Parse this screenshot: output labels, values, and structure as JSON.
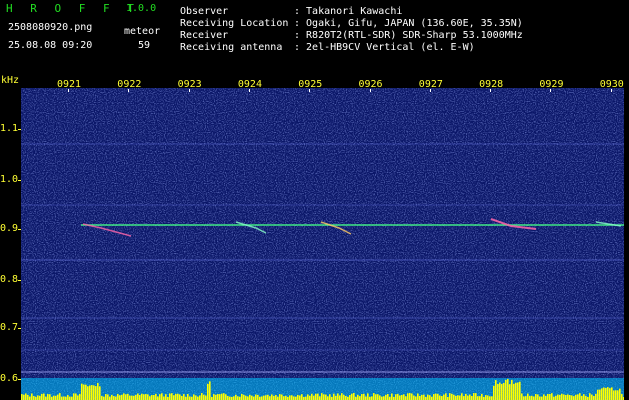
{
  "header": {
    "app_name": "H R O F F T",
    "app_version": "1.0.0",
    "filename": "2508080920.png",
    "datetime": "25.08.08 09:20",
    "meteor_label": "meteor",
    "meteor_count": "59"
  },
  "info": {
    "observer_label": "Observer",
    "observer_value": ": Takanori Kawachi",
    "location_label": "Receiving Location",
    "location_value": ": Ogaki, Gifu, JAPAN (136.60E, 35.35N)",
    "receiver_label": "Receiver",
    "receiver_value": ": R820T2(RTL-SDR) SDR-Sharp 53.1000MHz",
    "antenna_label": "Receiving antenna",
    "antenna_value": ": 2el-HB9CV Vertical (el. E-W)"
  },
  "chart_data": {
    "type": "heatmap",
    "ylabel": "kHz",
    "y_ticks": [
      "1.1",
      "1.0",
      "0.9",
      "0.8",
      "0.7",
      "0.6"
    ],
    "x_ticks": [
      "0921",
      "0922",
      "0923",
      "0924",
      "0925",
      "0926",
      "0927",
      "0928",
      "0929",
      "0930"
    ],
    "background_color": "#0a1668",
    "trace_color": "#44ff88",
    "footer_color": "#ffff00"
  }
}
